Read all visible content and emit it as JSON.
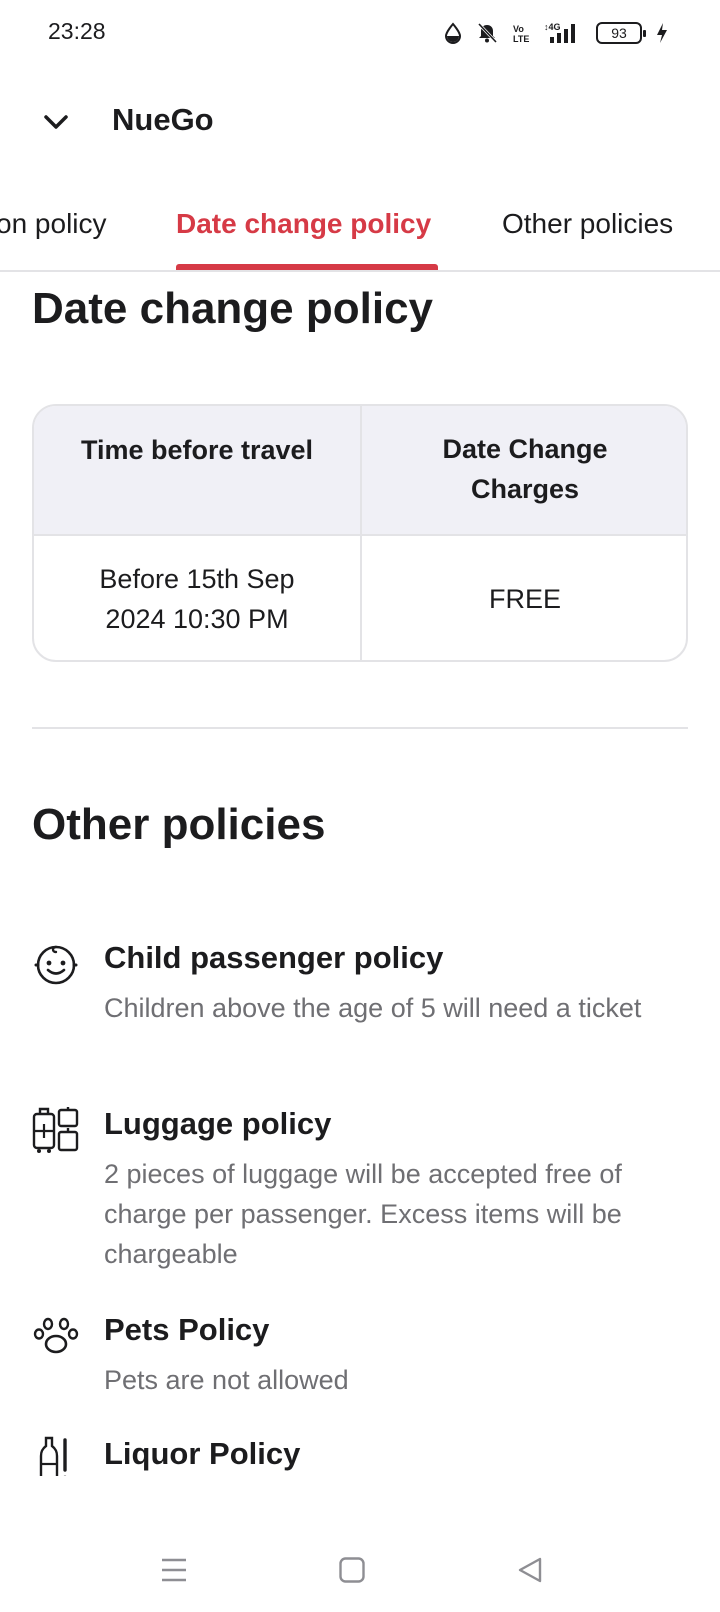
{
  "status_bar": {
    "time": "23:28",
    "battery_level": "93",
    "icons": [
      "data-saver-icon",
      "bell-off-icon",
      "volte-icon",
      "signal-4g-icon",
      "battery-icon",
      "charging-icon"
    ]
  },
  "header": {
    "back_icon": "chevron-down-icon",
    "title": "NueGo"
  },
  "tabs": [
    {
      "label": "on policy",
      "active": false
    },
    {
      "label": "Date change policy",
      "active": true
    },
    {
      "label": "Other policies",
      "active": false
    }
  ],
  "accent_color": "#d63a46",
  "date_change": {
    "title": "Date change policy",
    "table": {
      "headers": [
        "Time before travel",
        "Date Change Charges"
      ],
      "header_lines": [
        [
          "Time before travel"
        ],
        [
          "Date Change",
          "Charges"
        ]
      ],
      "rows": [
        {
          "time_lines": [
            "Before 15th Sep",
            "2024 10:30 PM"
          ],
          "charge": "FREE"
        }
      ]
    }
  },
  "other_policies": {
    "title": "Other policies",
    "items": [
      {
        "icon": "child-face-icon",
        "title": "Child passenger policy",
        "description": "Children above the age of 5 will need a ticket"
      },
      {
        "icon": "luggage-icon",
        "title": "Luggage policy",
        "description": "2 pieces of luggage will be accepted free of charge per passenger. Excess items will be chargeable"
      },
      {
        "icon": "paw-icon",
        "title": "Pets Policy",
        "description": "Pets are not allowed"
      },
      {
        "icon": "bottle-icon",
        "title": "Liquor Policy",
        "description": ""
      }
    ]
  },
  "nav_bar": {
    "buttons": [
      "menu-icon",
      "home-square-icon",
      "back-triangle-icon"
    ]
  }
}
